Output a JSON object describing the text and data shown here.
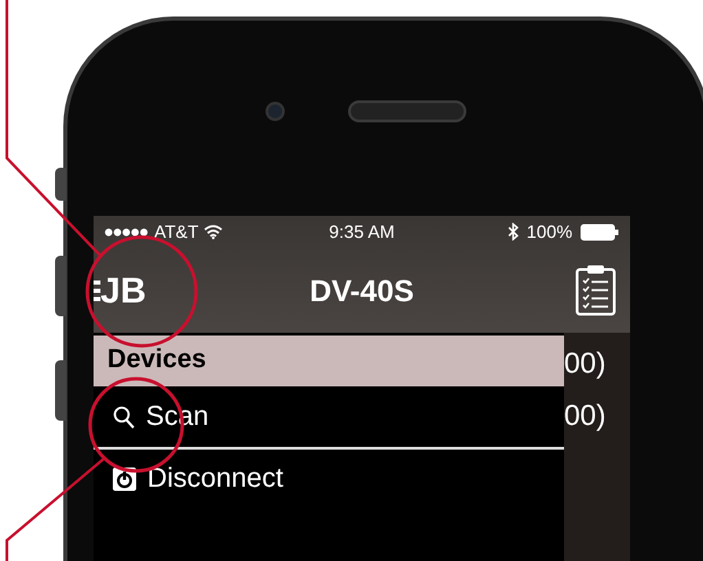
{
  "status_bar": {
    "carrier": "AT&T",
    "time": "9:35 AM",
    "battery": "100%"
  },
  "nav_bar": {
    "logo": "JB",
    "title": "DV-40S"
  },
  "drawer": {
    "header": "Devices",
    "items": [
      {
        "kind": "scan",
        "label": "Scan"
      },
      {
        "kind": "disconnect",
        "label": "Disconnect"
      }
    ]
  },
  "background_list": [
    "00)",
    "00)"
  ]
}
